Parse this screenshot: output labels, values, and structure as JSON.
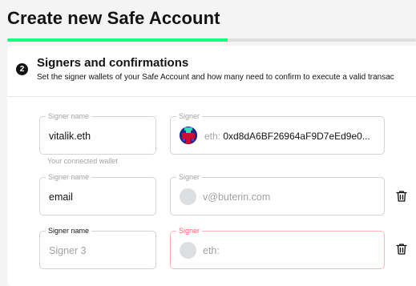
{
  "page": {
    "title": "Create new Safe Account",
    "progress_percent": 54
  },
  "colors": {
    "accent": "#12ff80",
    "error_border": "#ffb4bd",
    "error_label": "#ff5f72"
  },
  "section": {
    "step_number": "2",
    "title": "Signers and confirmations",
    "description": "Set the signer wallets of your Safe Account and how many need to confirm to execute a valid transac"
  },
  "signers": [
    {
      "name_label": "Signer name",
      "name_value": "vitalik.eth",
      "helper": "Your connected wallet",
      "signer_label": "Signer",
      "prefix": "eth:",
      "address": "0xd8dA6BF26964aF9D7eEd9e0...",
      "avatar": "identicon"
    },
    {
      "name_label": "Signer name",
      "name_value": "email",
      "signer_label": "Signer",
      "address": "v@buterin.com",
      "avatar": "empty-circle",
      "delete_icon": "trash-icon"
    },
    {
      "name_label": "Signer name",
      "name_placeholder": "Signer 3",
      "signer_label": "Signer",
      "prefix": "eth:",
      "avatar": "empty-circle",
      "state": "error",
      "delete_icon": "trash-icon"
    }
  ]
}
